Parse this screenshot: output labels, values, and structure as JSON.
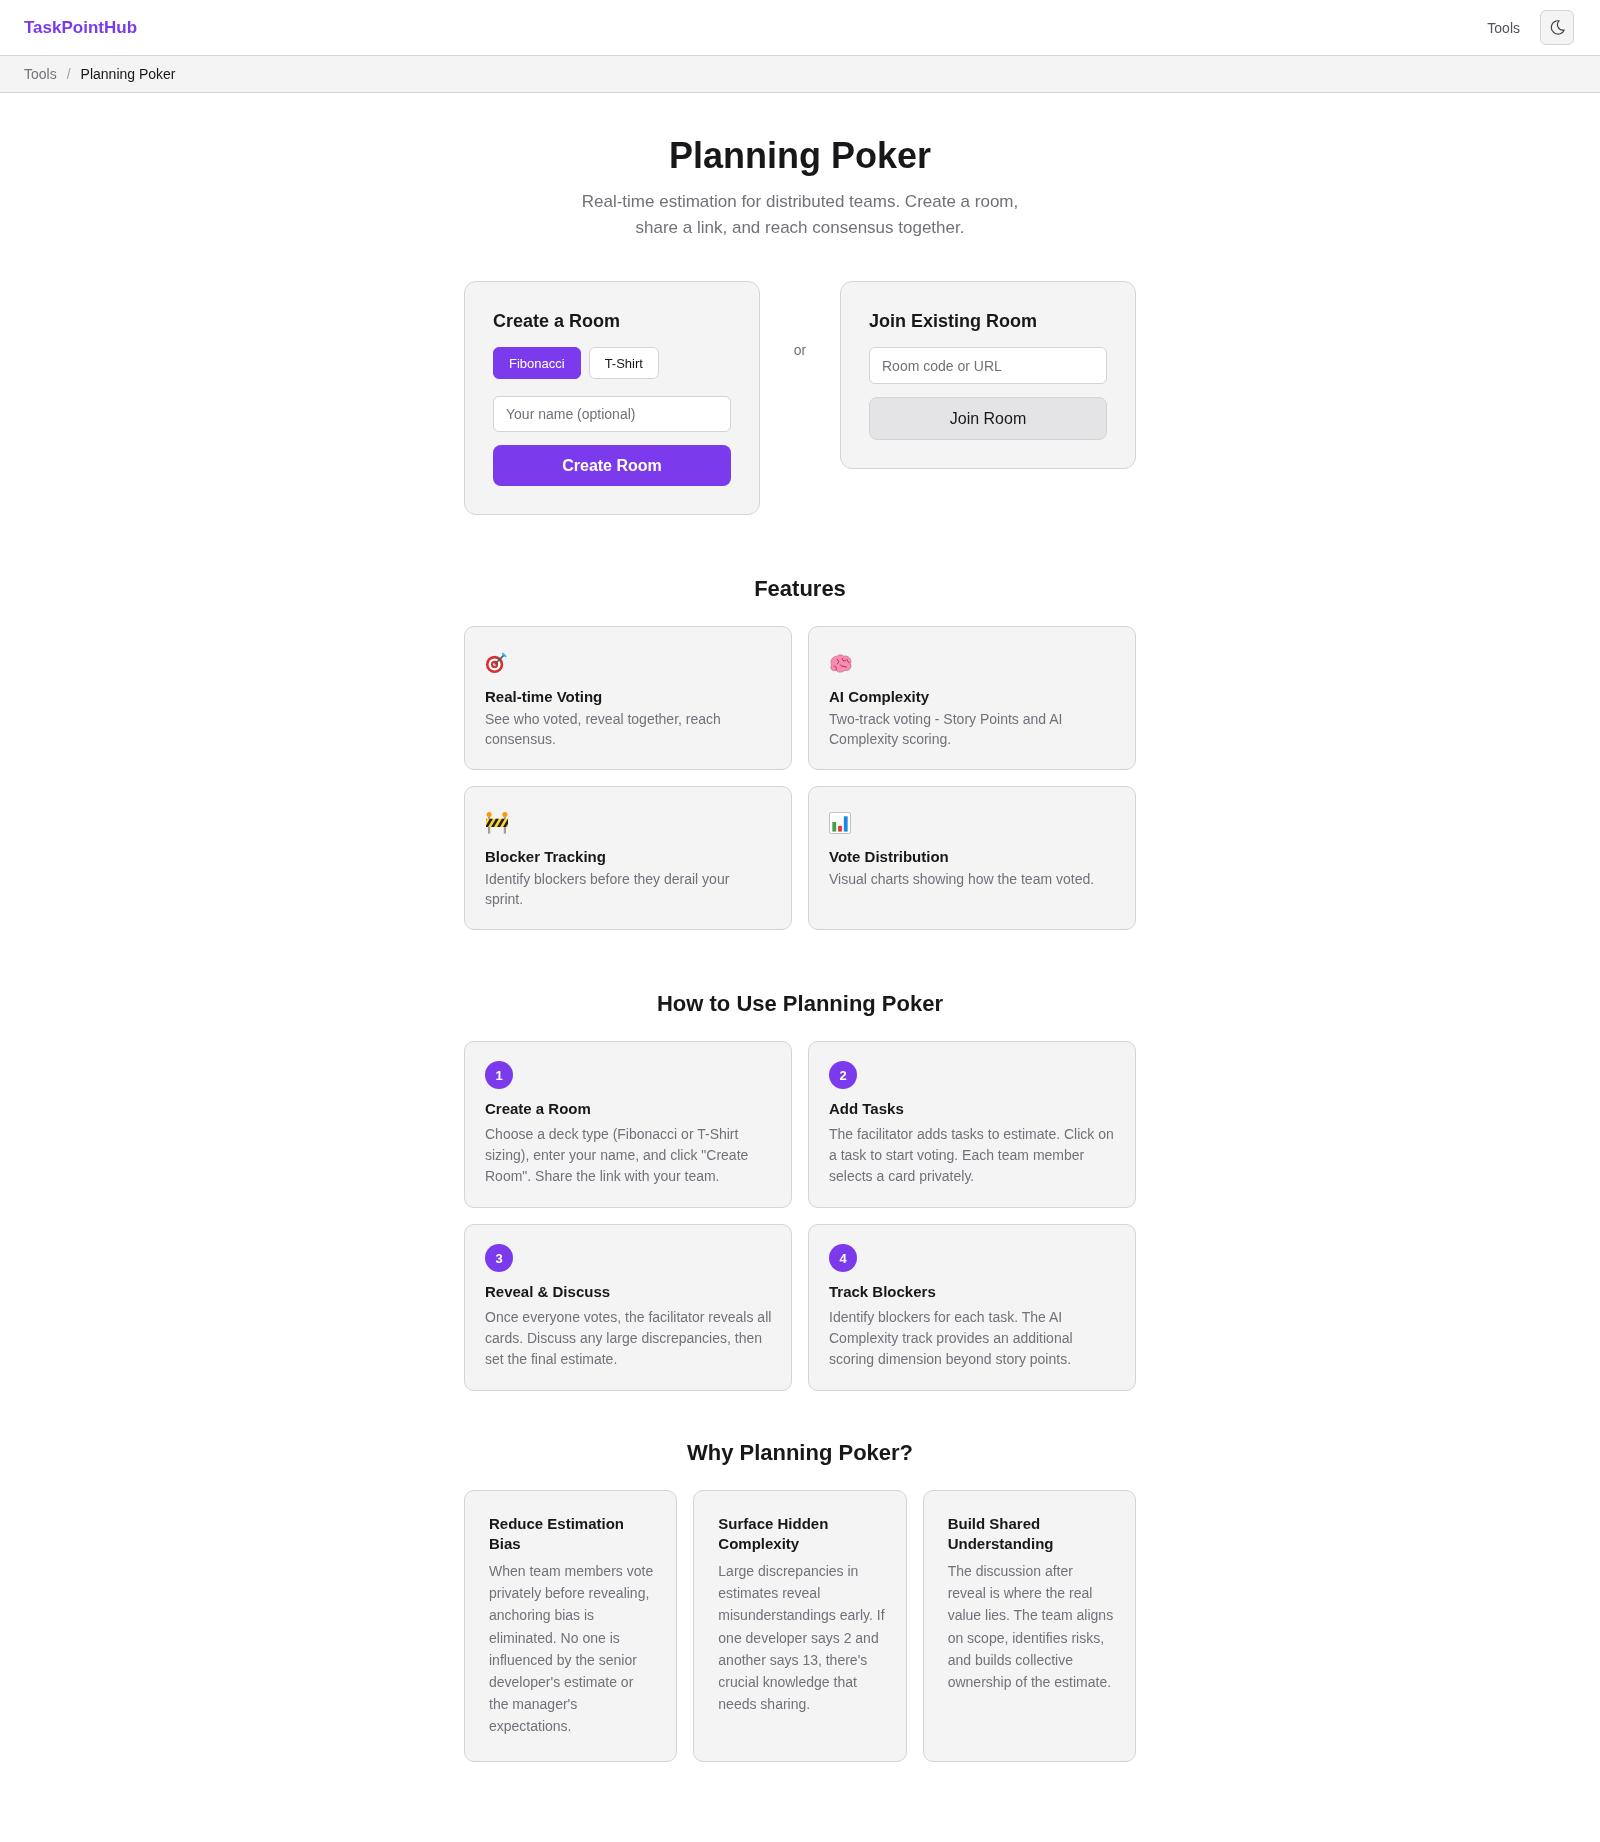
{
  "header": {
    "logo": "TaskPointHub",
    "nav_link": "Tools"
  },
  "breadcrumb": {
    "separator": "/",
    "items": [
      {
        "label": "Tools",
        "current": false
      },
      {
        "label": "Planning Poker",
        "current": true
      }
    ]
  },
  "hero": {
    "title": "Planning Poker",
    "subtitle": "Real-time estimation for distributed teams. Create a room, share a link, and reach consensus together."
  },
  "create_room": {
    "title": "Create a Room",
    "deck_options": [
      {
        "label": "Fibonacci",
        "selected": true
      },
      {
        "label": "T-Shirt",
        "selected": false
      }
    ],
    "name_field": {
      "placeholder": "Your name (optional)"
    },
    "button": "Create Room"
  },
  "divider_text": "or",
  "join_room": {
    "title": "Join Existing Room",
    "room_field": {
      "placeholder": "Room code or URL"
    },
    "button": "Join Room"
  },
  "features": {
    "heading": "Features",
    "items": [
      {
        "kind": "target",
        "title": "Real-time Voting",
        "description": "See who voted, reveal together, reach consensus."
      },
      {
        "kind": "brain",
        "title": "AI Complexity",
        "description": "Two-track voting - Story Points and AI Complexity scoring."
      },
      {
        "kind": "barrier",
        "title": "Blocker Tracking",
        "description": "Identify blockers before they derail your sprint."
      },
      {
        "kind": "chart",
        "title": "Vote Distribution",
        "description": "Visual charts showing how the team voted."
      }
    ]
  },
  "how_to": {
    "heading": "How to Use Planning Poker",
    "steps": [
      {
        "number": "1",
        "title": "Create a Room",
        "description": "Choose a deck type (Fibonacci or T-Shirt sizing), enter your name, and click \"Create Room\". Share the link with your team."
      },
      {
        "number": "2",
        "title": "Add Tasks",
        "description": "The facilitator adds tasks to estimate. Click on a task to start voting. Each team member selects a card privately."
      },
      {
        "number": "3",
        "title": "Reveal & Discuss",
        "description": "Once everyone votes, the facilitator reveals all cards. Discuss any large discrepancies, then set the final estimate."
      },
      {
        "number": "4",
        "title": "Track Blockers",
        "description": "Identify blockers for each task. The AI Complexity track provides an additional scoring dimension beyond story points."
      }
    ]
  },
  "why": {
    "heading": "Why Planning Poker?",
    "reasons": [
      {
        "title": "Reduce Estimation Bias",
        "description": "When team members vote privately before revealing, anchoring bias is eliminated. No one is influenced by the senior developer's estimate or the manager's expectations."
      },
      {
        "title": "Surface Hidden Complexity",
        "description": "Large discrepancies in estimates reveal misunderstandings early. If one developer says 2 and another says 13, there's crucial knowledge that needs sharing."
      },
      {
        "title": "Build Shared Understanding",
        "description": "The discussion after reveal is where the real value lies. The team aligns on scope, identifies risks, and builds collective ownership of the estimate."
      }
    ]
  }
}
